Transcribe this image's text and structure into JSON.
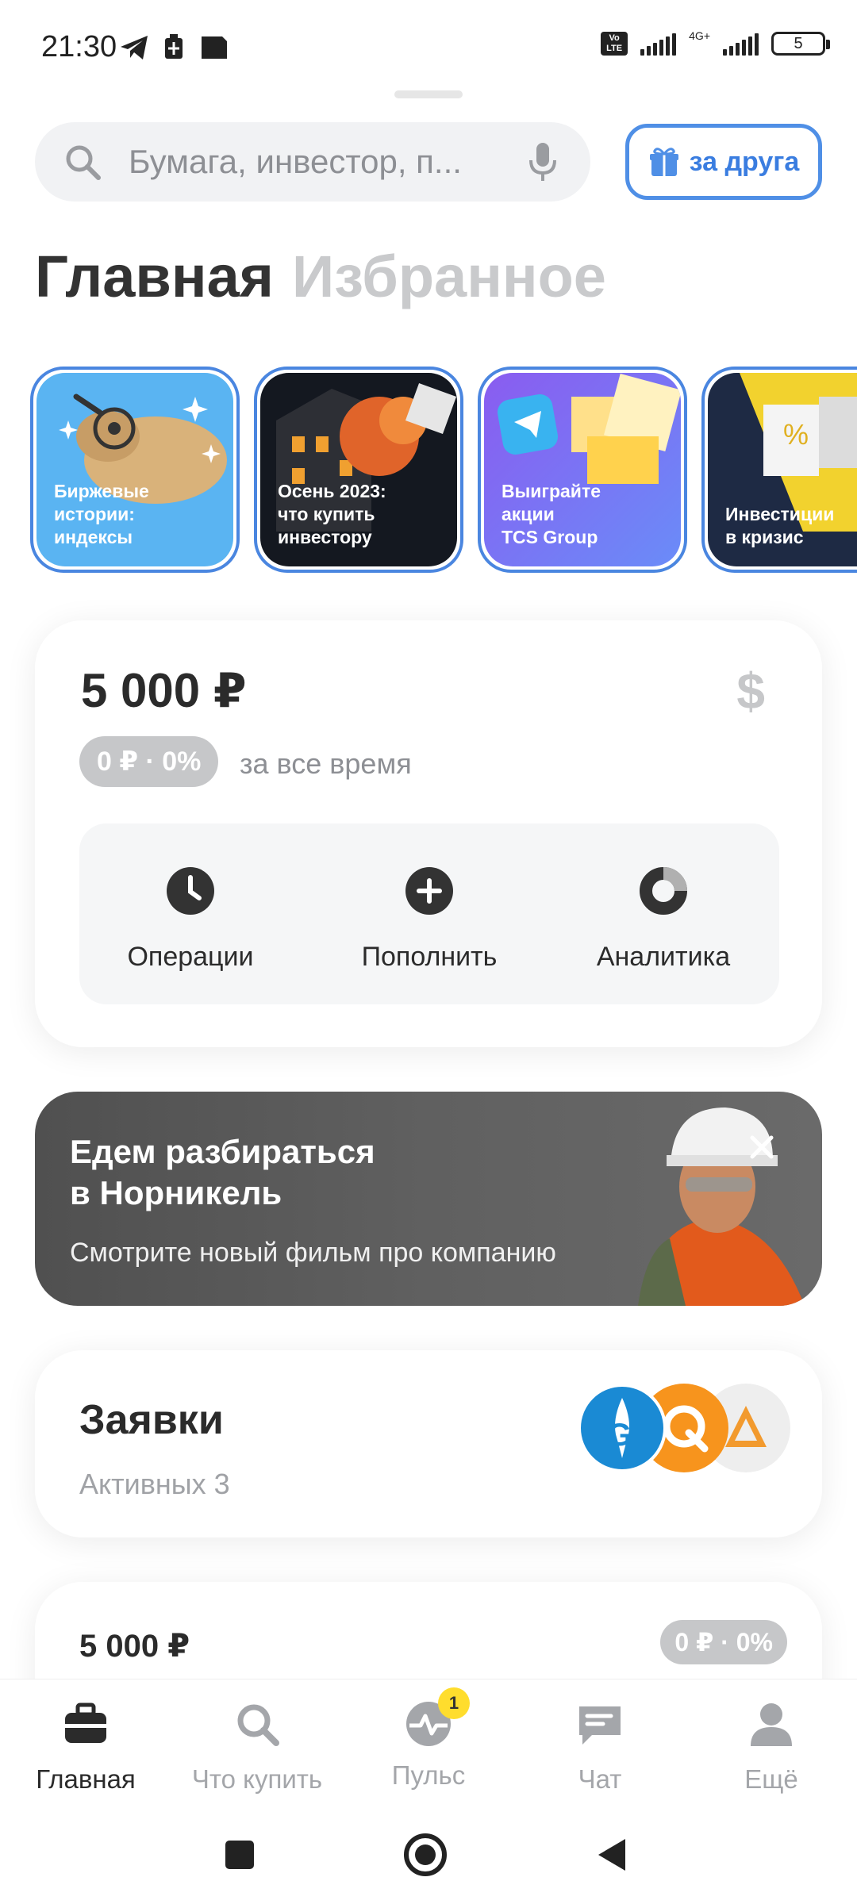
{
  "status_bar": {
    "time": "21:30",
    "network": "4G+",
    "battery": "5"
  },
  "search": {
    "placeholder": "Бумага, инвестор, п..."
  },
  "invite": {
    "label": "за друга"
  },
  "tabs": {
    "main": "Главная",
    "favorites": "Избранное"
  },
  "stories": [
    {
      "text": "Биржевые\nистории:\nиндексы"
    },
    {
      "text": "Осень 2023:\nчто купить\nинвестору"
    },
    {
      "text": "Выиграйте\nакции\nTCS Group"
    },
    {
      "text": "Инвестиции\nв кризис"
    }
  ],
  "portfolio": {
    "amount": "5 000 ₽",
    "currency_icon": "$",
    "change_badge": "0 ₽ · 0%",
    "period": "за все время",
    "actions": [
      {
        "label": "Операции",
        "icon": "clock-icon"
      },
      {
        "label": "Пополнить",
        "icon": "plus-icon"
      },
      {
        "label": "Аналитика",
        "icon": "donut-chart-icon"
      }
    ]
  },
  "banner": {
    "title": "Едем разбираться\nв Норникель",
    "subtitle": "Смотрите новый фильм про компанию"
  },
  "orders": {
    "title": "Заявки",
    "subtitle": "Активных 3"
  },
  "account": {
    "amount": "5 000 ₽",
    "change_badge": "0 ₽ · 0%"
  },
  "bottom_nav": {
    "items": [
      {
        "label": "Главная",
        "icon": "briefcase-icon",
        "active": true
      },
      {
        "label": "Что купить",
        "icon": "search-icon"
      },
      {
        "label": "Пульс",
        "icon": "pulse-icon",
        "badge": "1"
      },
      {
        "label": "Чат",
        "icon": "chat-icon"
      },
      {
        "label": "Ещё",
        "icon": "profile-icon"
      }
    ]
  },
  "colors": {
    "accent_blue": "#3a7de0",
    "badge_yellow": "#ffdd2d",
    "muted_gray": "#c6c7c9"
  }
}
